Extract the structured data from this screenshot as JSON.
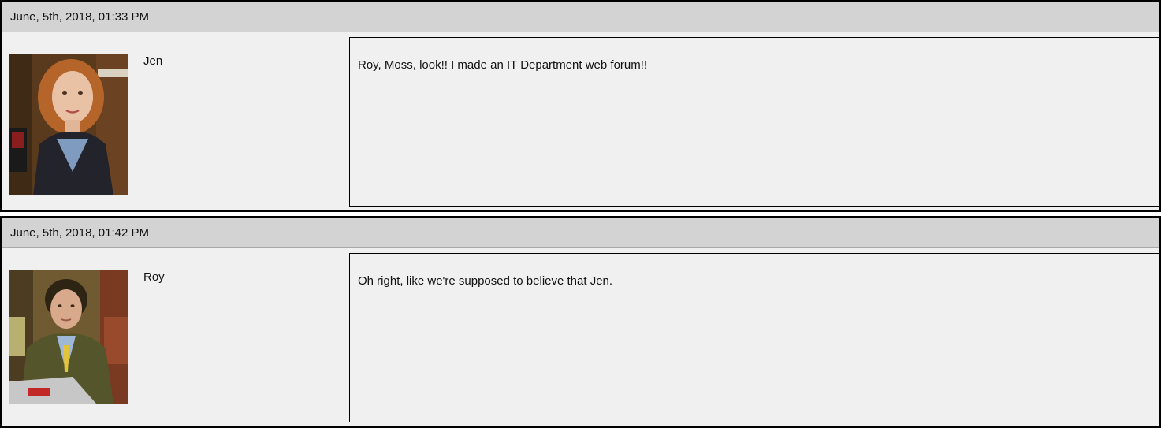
{
  "posts": [
    {
      "date": "June, 5th, 2018, 01:33 PM",
      "author": "Jen",
      "avatar_icon": "user-photo-jen",
      "message": "Roy, Moss, look!! I made an IT Department web forum!!"
    },
    {
      "date": "June, 5th, 2018, 01:42 PM",
      "author": "Roy",
      "avatar_icon": "user-photo-roy",
      "message": "Oh right, like we're supposed to believe that Jen."
    }
  ]
}
